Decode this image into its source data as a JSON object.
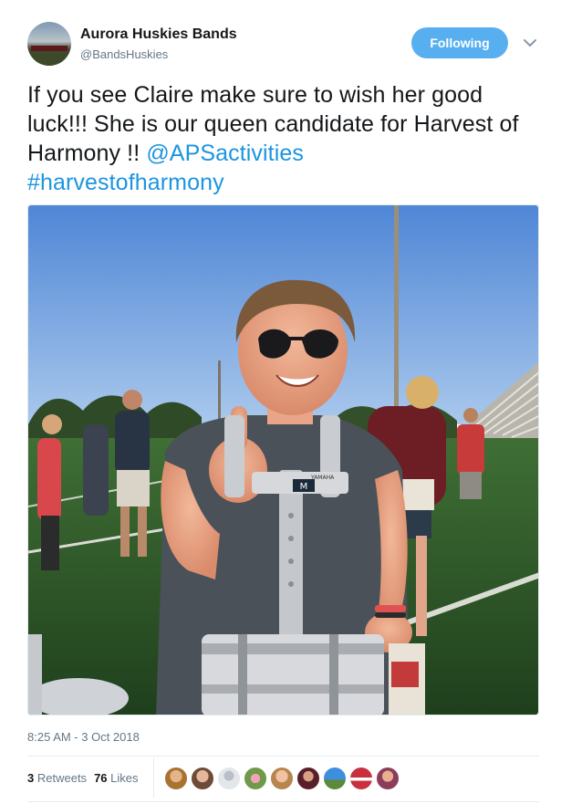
{
  "account": {
    "name": "Aurora Huskies Bands",
    "handle": "@BandsHuskies",
    "follow_label": "Following"
  },
  "icons": {
    "caret": "chevron-down-icon"
  },
  "tweet": {
    "text_part1": "If you see Claire make sure to wish her good luck!!!  She is our queen candidate for Harvest of Harmony !! ",
    "mention": "@APSactivities",
    "hashtag": "#harvestofharmony",
    "timestamp": "8:25 AM - 3 Oct 2018"
  },
  "media": {
    "harness_label": "M",
    "tag_label": "YAMAHA"
  },
  "stats": {
    "retweets_count": "3",
    "retweets_label": "Retweets",
    "likes_count": "76",
    "likes_label": "Likes"
  },
  "colors": {
    "link": "#1b95e0",
    "follow_button": "#58aff0",
    "muted": "#657786"
  }
}
